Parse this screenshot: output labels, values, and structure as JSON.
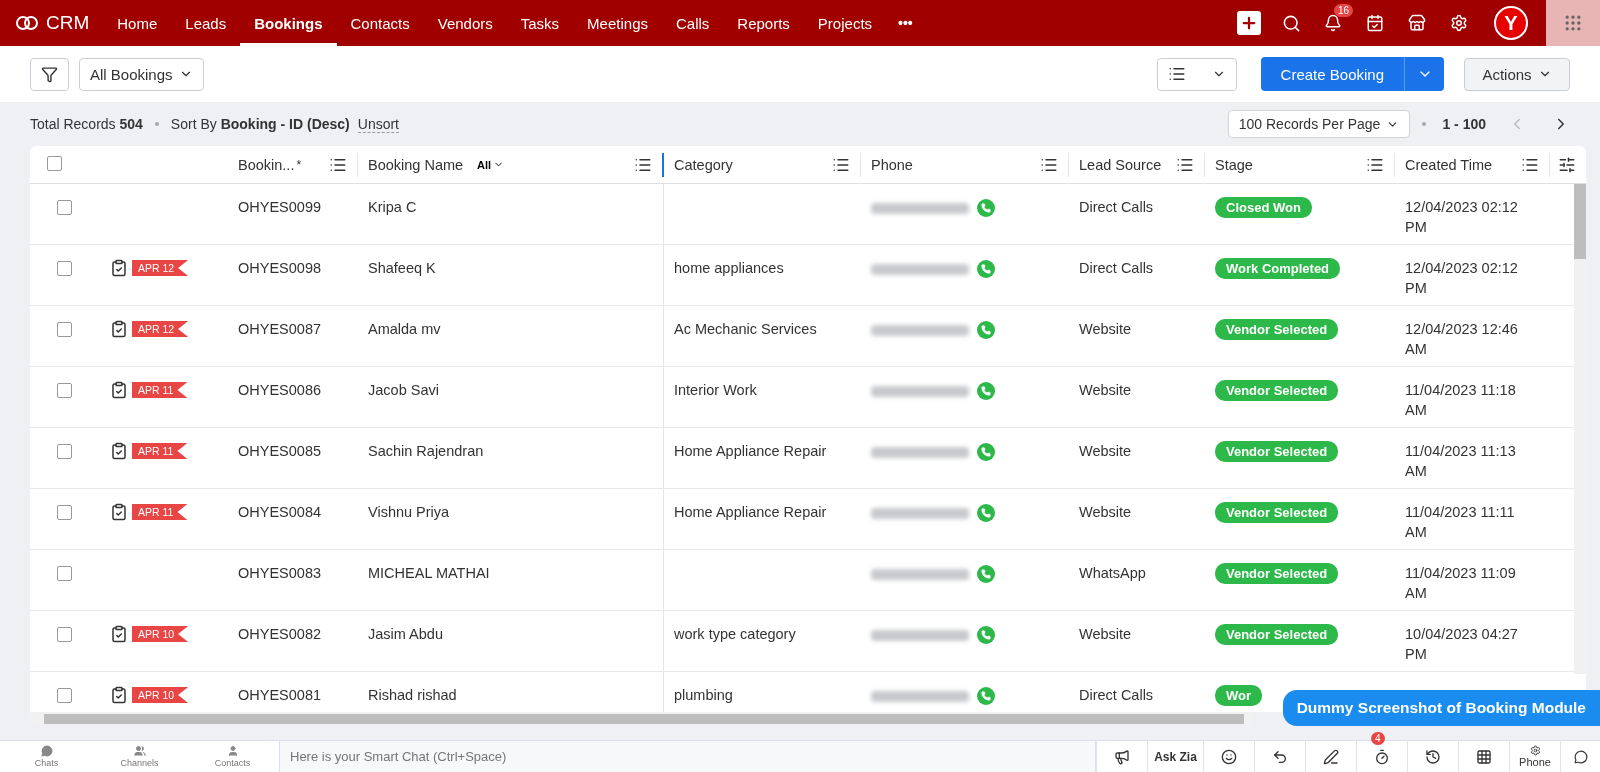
{
  "app": {
    "name": "CRM"
  },
  "nav": [
    {
      "label": "Home",
      "selected": false
    },
    {
      "label": "Leads",
      "selected": false
    },
    {
      "label": "Bookings",
      "selected": true
    },
    {
      "label": "Contacts",
      "selected": false
    },
    {
      "label": "Vendors",
      "selected": false
    },
    {
      "label": "Tasks",
      "selected": false
    },
    {
      "label": "Meetings",
      "selected": false
    },
    {
      "label": "Calls",
      "selected": false
    },
    {
      "label": "Reports",
      "selected": false
    },
    {
      "label": "Projects",
      "selected": false
    }
  ],
  "nav_more": "•••",
  "notifications": {
    "count": "16"
  },
  "avatar": {
    "letter": "Y"
  },
  "toolbar": {
    "view": "All Bookings",
    "create": "Create Booking",
    "actions": "Actions"
  },
  "summary": {
    "total_label": "Total Records",
    "total": "504",
    "sort_label": "Sort By",
    "sort": "Booking - ID (Desc)",
    "unsort": "Unsort",
    "per_page": "100 Records Per Page",
    "range": "1 - 100"
  },
  "table": {
    "select_all": {
      "checked": false
    },
    "columns": [
      {
        "label": "Bookin...",
        "mark": "*"
      },
      {
        "label": "Booking Name",
        "filter": "All"
      },
      {
        "label": "Category"
      },
      {
        "label": "Phone"
      },
      {
        "label": "Lead Source"
      },
      {
        "label": "Stage"
      },
      {
        "label": "Created Time"
      }
    ],
    "rows": [
      {
        "checked": false,
        "id": "OHYES0099",
        "name": "Kripa C",
        "category": "",
        "lead_source": "Direct Calls",
        "stage": "Closed Won",
        "created": "12/04/2023 02:12 PM"
      },
      {
        "checked": false,
        "task": "APR 12",
        "id": "OHYES0098",
        "name": "Shafeeq K",
        "category": "home appliances",
        "lead_source": "Direct Calls",
        "stage": "Work Completed",
        "created": "12/04/2023 02:12 PM"
      },
      {
        "checked": false,
        "task": "APR 12",
        "id": "OHYES0087",
        "name": "Amalda mv",
        "category": "Ac Mechanic Services",
        "lead_source": "Website",
        "stage": "Vendor Selected",
        "created": "12/04/2023 12:46 AM"
      },
      {
        "checked": false,
        "task": "APR 11",
        "id": "OHYES0086",
        "name": "Jacob Savi",
        "category": "Interior Work",
        "lead_source": "Website",
        "stage": "Vendor Selected",
        "created": "11/04/2023 11:18 AM"
      },
      {
        "checked": false,
        "task": "APR 11",
        "id": "OHYES0085",
        "name": "Sachin Rajendran",
        "category": "Home Appliance Repair",
        "lead_source": "Website",
        "stage": "Vendor Selected",
        "created": "11/04/2023 11:13 AM"
      },
      {
        "checked": false,
        "task": "APR 11",
        "id": "OHYES0084",
        "name": "Vishnu Priya",
        "category": "Home Appliance Repair",
        "lead_source": "Website",
        "stage": "Vendor Selected",
        "created": "11/04/2023 11:11 AM"
      },
      {
        "checked": false,
        "id": "OHYES0083",
        "name": "MICHEAL MATHAI",
        "category": "",
        "lead_source": "WhatsApp",
        "stage": "Vendor Selected",
        "created": "11/04/2023 11:09 AM"
      },
      {
        "checked": false,
        "task": "APR 10",
        "id": "OHYES0082",
        "name": "Jasim Abdu",
        "category": "work type category",
        "lead_source": "Website",
        "stage": "Vendor Selected",
        "created": "10/04/2023 04:27 PM"
      },
      {
        "checked": false,
        "task": "APR 10",
        "id": "OHYES0081",
        "name": "Rishad rishad",
        "category": "plumbing",
        "lead_source": "Direct Calls",
        "stage": "Wor",
        "created": ""
      }
    ]
  },
  "banner": "Dummy Screenshot of Booking Module",
  "bottom": {
    "shortcuts": [
      "Chats",
      "Channels",
      "Contacts"
    ],
    "chat_placeholder": "Here is your Smart Chat (Ctrl+Space)",
    "ask_zia": "Ask Zia",
    "reminder_count": "4",
    "phone": "Phone"
  }
}
